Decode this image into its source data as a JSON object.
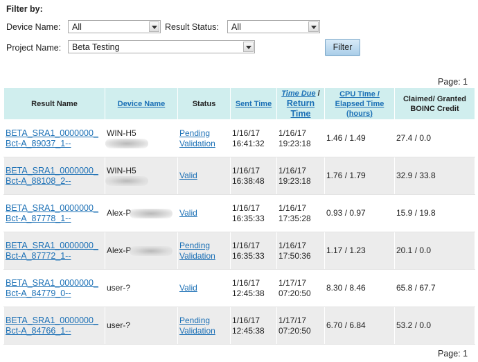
{
  "filter": {
    "title": "Filter by:",
    "device_label": "Device Name:",
    "device_value": "All",
    "status_label": "Result Status:",
    "status_value": "All",
    "project_label": "Project Name:",
    "project_value": "Beta Testing",
    "button_label": "Filter"
  },
  "pagination": {
    "top": "Page: 1",
    "bottom": "Page: 1"
  },
  "table": {
    "headers": {
      "result_name": "Result Name",
      "device_name": "Device Name",
      "status": "Status",
      "sent_time": "Sent Time",
      "time_due": "Time Due",
      "return_time": "Return Time",
      "cpu_time": "CPU Time /",
      "elapsed_time": "Elapsed Time (hours)",
      "credit": "Claimed/ Granted BOINC Credit"
    },
    "rows": [
      {
        "name1": "BETA_SRA1_0000000_",
        "name2": "Bct-A_89037_1--",
        "device": "WIN-H5",
        "status1": "Pending",
        "status2": "Validation",
        "sent1": "1/16/17",
        "sent2": "16:41:32",
        "ret1": "1/16/17",
        "ret2": "19:23:18",
        "cpu": "1.46 / 1.49",
        "credit": "27.4 / 0.0"
      },
      {
        "name1": "BETA_SRA1_0000000_",
        "name2": "Bct-A_88108_2--",
        "device": "WIN-H5",
        "status1": "Valid",
        "status2": "",
        "sent1": "1/16/17",
        "sent2": "16:38:48",
        "ret1": "1/16/17",
        "ret2": "19:23:18",
        "cpu": "1.76 / 1.79",
        "credit": "32.9 / 33.8"
      },
      {
        "name1": "BETA_SRA1_0000000_",
        "name2": "Bct-A_87778_1--",
        "device": "Alex-P",
        "status1": "Valid",
        "status2": "",
        "sent1": "1/16/17",
        "sent2": "16:35:33",
        "ret1": "1/16/17",
        "ret2": "17:35:28",
        "cpu": "0.93 / 0.97",
        "credit": "15.9 / 19.8"
      },
      {
        "name1": "BETA_SRA1_0000000_",
        "name2": "Bct-A_87772_1--",
        "device": "Alex-P",
        "status1": "Pending",
        "status2": "Validation",
        "sent1": "1/16/17",
        "sent2": "16:35:33",
        "ret1": "1/16/17",
        "ret2": "17:50:36",
        "cpu": "1.17 / 1.23",
        "credit": "20.1 / 0.0"
      },
      {
        "name1": "BETA_SRA1_0000000_",
        "name2": "Bct-A_84779_0--",
        "device": "user-?",
        "status1": "Valid",
        "status2": "",
        "sent1": "1/16/17",
        "sent2": "12:45:38",
        "ret1": "1/17/17",
        "ret2": "07:20:50",
        "cpu": "8.30 / 8.46",
        "credit": "65.8 / 67.7"
      },
      {
        "name1": "BETA_SRA1_0000000_",
        "name2": "Bct-A_84766_1--",
        "device": "user-?",
        "status1": "Pending",
        "status2": "Validation",
        "sent1": "1/16/17",
        "sent2": "12:45:38",
        "ret1": "1/17/17",
        "ret2": "07:20:50",
        "cpu": "6.70 / 6.84",
        "credit": "53.2 / 0.0"
      }
    ]
  }
}
